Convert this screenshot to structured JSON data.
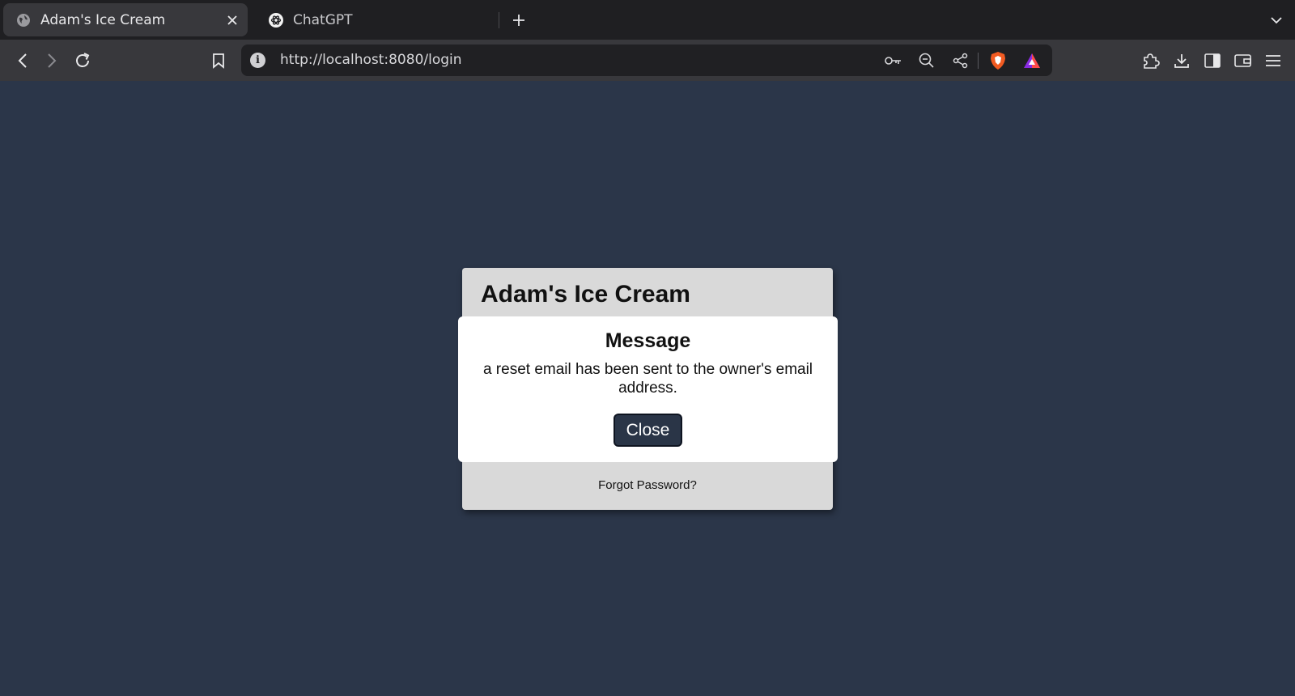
{
  "browser": {
    "tabs": [
      {
        "title": "Adam's Ice Cream",
        "icon": "globe-icon",
        "active": true
      },
      {
        "title": "ChatGPT",
        "icon": "openai-icon",
        "active": false
      }
    ],
    "url": "http://localhost:8080/login"
  },
  "page": {
    "background_color": "#2b3649",
    "brand_title": "Adam's Ice Cream",
    "forgot_password_link": "Forgot Password?"
  },
  "modal": {
    "title": "Message",
    "body": "a reset email has been sent to the owner's email address.",
    "close_label": "Close"
  }
}
